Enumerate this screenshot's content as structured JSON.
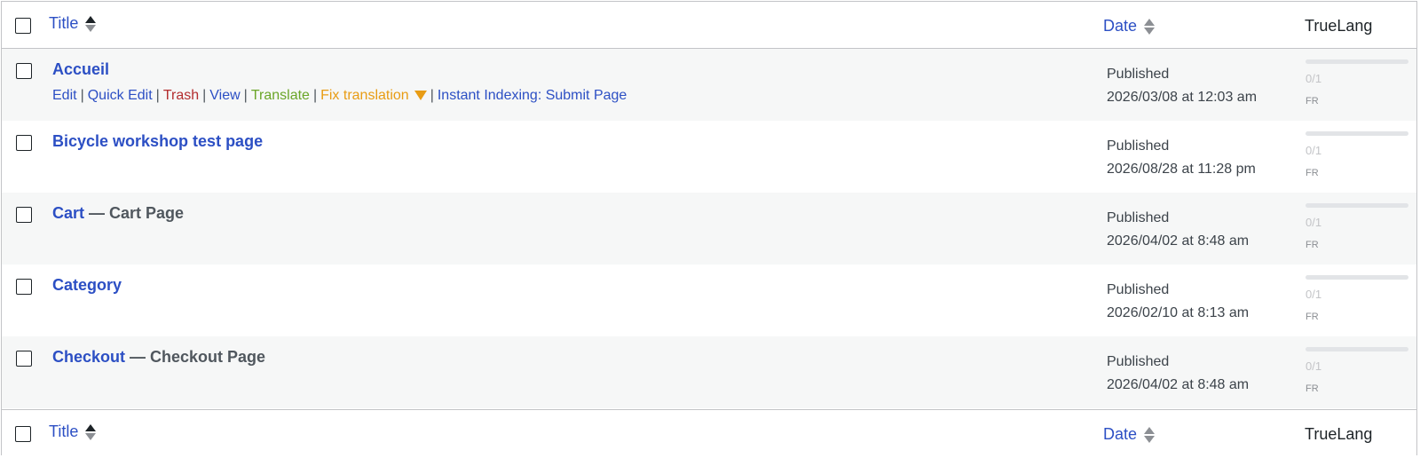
{
  "header": {
    "title_label": "Title",
    "date_label": "Date",
    "lang_label": "TrueLang"
  },
  "footer": {
    "title_label": "Title",
    "date_label": "Date",
    "lang_label": "TrueLang"
  },
  "row_actions": {
    "edit": "Edit",
    "quick_edit": "Quick Edit",
    "trash": "Trash",
    "view": "View",
    "translate": "Translate",
    "fix_translation": "Fix translation",
    "instant_indexing": "Instant Indexing: Submit Page",
    "separator": "|"
  },
  "rows": [
    {
      "title": "Accueil",
      "state": "",
      "status": "Published",
      "date": "2026/03/08 at 12:03 am",
      "lang_count": "0/1",
      "lang_code": "FR"
    },
    {
      "title": "Bicycle workshop test page",
      "state": "",
      "status": "Published",
      "date": "2026/08/28 at 11:28 pm",
      "lang_count": "0/1",
      "lang_code": "FR"
    },
    {
      "title": "Cart",
      "state": "— Cart Page",
      "status": "Published",
      "date": "2026/04/02 at 8:48 am",
      "lang_count": "0/1",
      "lang_code": "FR"
    },
    {
      "title": "Category",
      "state": "",
      "status": "Published",
      "date": "2026/02/10 at 8:13 am",
      "lang_count": "0/1",
      "lang_code": "FR"
    },
    {
      "title": "Checkout",
      "state": "— Checkout Page",
      "status": "Published",
      "date": "2026/04/02 at 8:48 am",
      "lang_count": "0/1",
      "lang_code": "FR"
    }
  ],
  "colors": {
    "link": "#2c4fc4",
    "trash": "#b32d2e",
    "translate": "#6aa528",
    "fix_translation": "#e89c14",
    "row_alt_bg": "#f6f7f7",
    "border": "#c3c4c7"
  }
}
